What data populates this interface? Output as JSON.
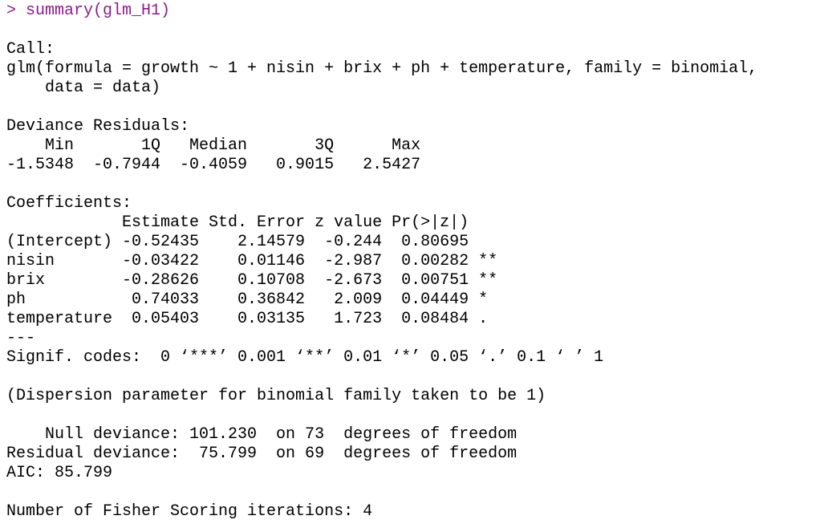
{
  "console": {
    "prompt": "> ",
    "command": "summary(glm_H1)",
    "colors": {
      "command": "#8e1a8e",
      "output": "#000000",
      "background": "#ffffff"
    }
  },
  "output": {
    "call_header": "Call:",
    "call_line1": "glm(formula = growth ~ 1 + nisin + brix + ph + temperature, family = binomial,",
    "call_line2": "    data = data)",
    "deviance_header": "Deviance Residuals:",
    "deviance_cols": "    Min       1Q   Median       3Q      Max  ",
    "deviance_vals": "-1.5348  -0.7944  -0.4059   0.9015   2.5427  ",
    "coef_header": "Coefficients:",
    "coef_cols": "            Estimate Std. Error z value Pr(>|z|)   ",
    "coef_rows": [
      "(Intercept) -0.52435    2.14579  -0.244  0.80695   ",
      "nisin       -0.03422    0.01146  -2.987  0.00282 **",
      "brix        -0.28626    0.10708  -2.673  0.00751 **",
      "ph           0.74033    0.36842   2.009  0.04449 * ",
      "temperature  0.05403    0.03135   1.723  0.08484 . "
    ],
    "separator": "---",
    "signif_codes": "Signif. codes:  0 ‘***’ 0.001 ‘**’ 0.01 ‘*’ 0.05 ‘.’ 0.1 ‘ ’ 1",
    "dispersion": "(Dispersion parameter for binomial family taken to be 1)",
    "null_deviance": "    Null deviance: 101.230  on 73  degrees of freedom",
    "residual_deviance": "Residual deviance:  75.799  on 69  degrees of freedom",
    "aic": "AIC: 85.799",
    "fisher": "Number of Fisher Scoring iterations: 4"
  }
}
